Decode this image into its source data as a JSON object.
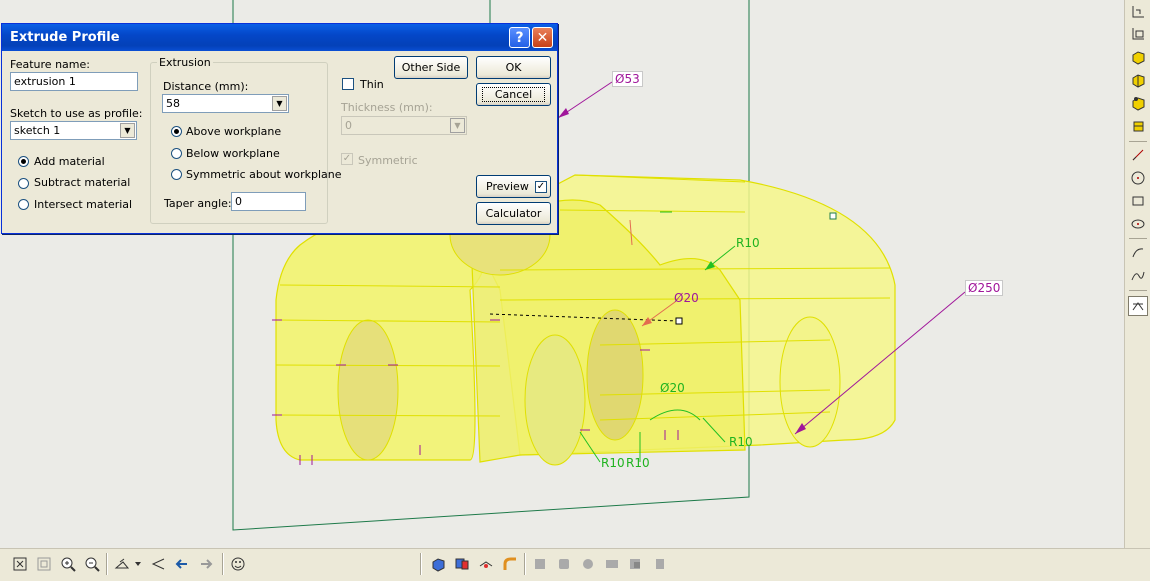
{
  "dialog": {
    "title": "Extrude Profile",
    "feature_name_label": "Feature name:",
    "feature_name_value": "extrusion 1",
    "sketch_label": "Sketch to use as profile:",
    "sketch_value": "sketch 1",
    "material_options": [
      {
        "label": "Add material",
        "selected": true
      },
      {
        "label": "Subtract material",
        "selected": false
      },
      {
        "label": "Intersect material",
        "selected": false
      }
    ],
    "extrusion": {
      "group_title": "Extrusion",
      "distance_label": "Distance (mm):",
      "distance_value": "58",
      "workplane_options": [
        {
          "label": "Above workplane",
          "selected": true
        },
        {
          "label": "Below workplane",
          "selected": false
        },
        {
          "label": "Symmetric about workplane",
          "selected": false
        }
      ],
      "taper_label": "Taper angle:",
      "taper_value": "0"
    },
    "thin_label": "Thin",
    "thin_checked": false,
    "thickness_label": "Thickness (mm):",
    "thickness_value": "0",
    "symmetric_label": "Symmetric",
    "symmetric_checked": true,
    "other_side_label": "Other Side",
    "ok_label": "OK",
    "cancel_label": "Cancel",
    "preview_label": "Preview",
    "preview_checked": true,
    "calculator_label": "Calculator",
    "help_glyph": "?",
    "close_glyph": "✕"
  },
  "dimensions": {
    "d53": "Ø53",
    "d250": "Ø250",
    "d20_top": "Ø20",
    "d20_bottom": "Ø20",
    "r10_upper": "R10",
    "r10_lower_a": "R10",
    "r10_lower_b": "R10",
    "r10_right": "R10"
  },
  "colors": {
    "solid_fill": "#f4f57a",
    "solid_edge": "#e4e400",
    "workplane": "#1e7a4a",
    "dimension_magenta": "#a0169a",
    "dimension_green": "#22c022",
    "title_bar": "#0a5fe6"
  },
  "right_toolbar_icons": [
    "workplane-origin-icon",
    "workplane-offset-icon",
    "extrude-icon",
    "revolve-icon",
    "sweep-icon",
    "loft-icon",
    "line-icon",
    "circle-icon",
    "rectangle-icon",
    "ellipse-icon",
    "arc-icon",
    "spline-icon",
    "trim-icon"
  ],
  "bottom_toolbar_icons": [
    "zoom-fit-icon",
    "zoom-window-icon",
    "zoom-in-icon",
    "zoom-out-icon",
    "view-orient-icon",
    "dropdown-icon",
    "previous-view-icon",
    "back-arrow-icon",
    "forward-arrow-icon",
    "smiley-icon",
    "shaded-view-icon",
    "color-icon",
    "render-icon",
    "curve-icon",
    "fillet-icon",
    "chamfer-icon",
    "shell-icon",
    "draft-icon",
    "pattern-icon",
    "mirror-icon"
  ]
}
